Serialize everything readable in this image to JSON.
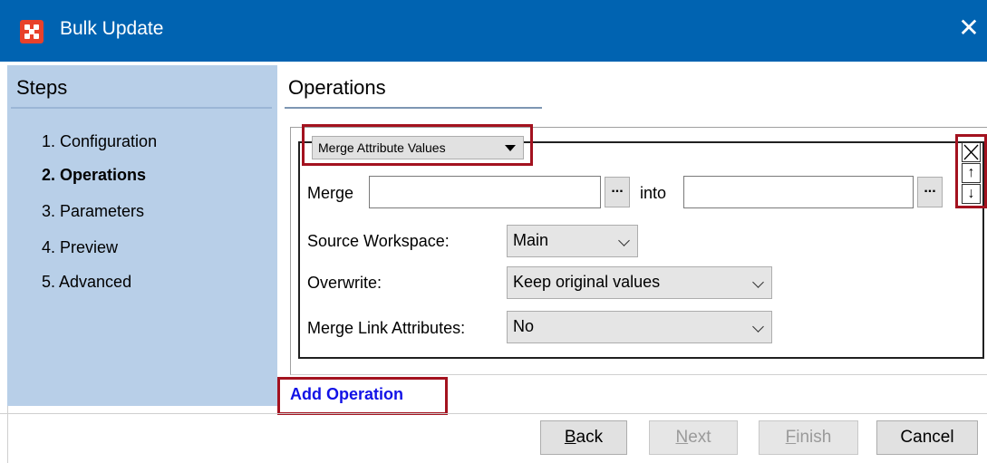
{
  "window": {
    "title": "Bulk Update",
    "close_icon": "close-icon",
    "app_icon": "bulk-update-app-icon"
  },
  "sidebar": {
    "heading": "Steps",
    "items": [
      {
        "label": "1. Configuration",
        "active": false
      },
      {
        "label": "2. Operations",
        "active": true
      },
      {
        "label": "3. Parameters",
        "active": false
      },
      {
        "label": "4. Preview",
        "active": false
      },
      {
        "label": "5. Advanced",
        "active": false
      }
    ]
  },
  "main": {
    "heading": "Operations",
    "operation": {
      "type": "Merge Attribute Values",
      "merge_label": "Merge",
      "merge_value": "",
      "browse_label": "...",
      "into_label": "into",
      "into_value": "",
      "source_workspace_label": "Source Workspace:",
      "source_workspace_value": "Main",
      "overwrite_label": "Overwrite:",
      "overwrite_value": "Keep original values",
      "merge_link_label": "Merge Link Attributes:",
      "merge_link_value": "No",
      "remove_icon": "remove-box-icon",
      "move_up_icon": "arrow-up-icon",
      "move_down_icon": "arrow-down-icon"
    },
    "add_operation": "Add Operation"
  },
  "footer": {
    "buttons": [
      {
        "key": "back",
        "mnemonic": "B",
        "rest": "ack",
        "enabled": true
      },
      {
        "key": "next",
        "mnemonic": "N",
        "rest": "ext",
        "enabled": false
      },
      {
        "key": "finish",
        "mnemonic": "F",
        "rest": "inish",
        "enabled": false
      },
      {
        "key": "cancel",
        "mnemonic": "",
        "rest": "Cancel",
        "enabled": true
      }
    ]
  },
  "colors": {
    "titlebar": "#0063b1",
    "sidebar": "#b8cfe8",
    "highlight": "#a3121f",
    "link": "#1212e6"
  }
}
